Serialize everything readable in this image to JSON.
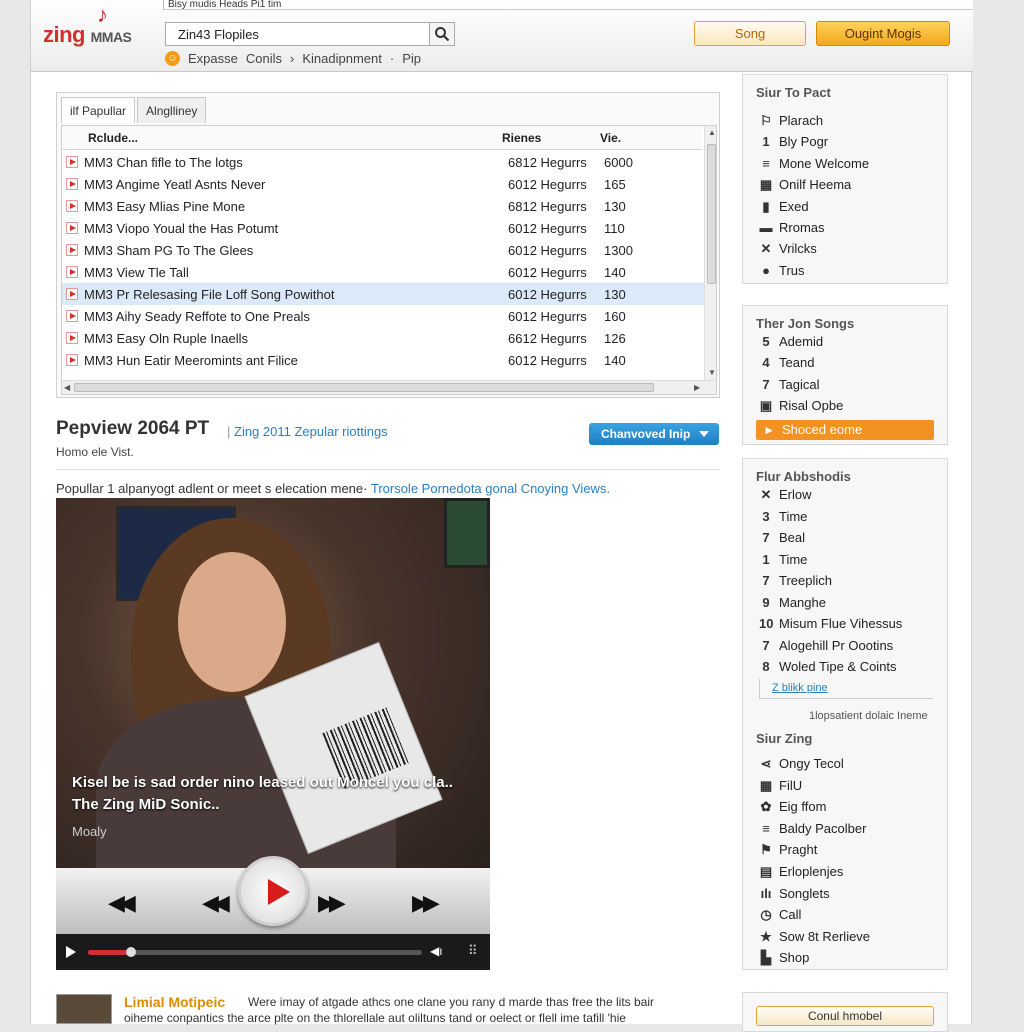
{
  "window": {
    "title": "Bisy mudis Heads Pi1 tim"
  },
  "logo": {
    "text": "zing",
    "suffix": "MMAS"
  },
  "search": {
    "value": "Zin43 Flopiles"
  },
  "subnav": [
    "Expasse",
    "Conils",
    "Kinadipnment",
    "Pip"
  ],
  "header_buttons": {
    "song": "Song",
    "login": "Ougint Mogis"
  },
  "tabs": [
    "ilf Papullar",
    "Alnglliney"
  ],
  "table": {
    "headers": [
      "Rclude...",
      "Rienes",
      "Vie."
    ],
    "rows": [
      {
        "title": "MM3 Chan fifle to The lotgs",
        "artist": "6812 Hegurrs",
        "views": "6000"
      },
      {
        "title": "MM3 Angime Yeatl Asnts Never",
        "artist": "6012 Hegurrs",
        "views": "165"
      },
      {
        "title": "MM3 Easy Mlias Pine Mone",
        "artist": "6812 Hegurrs",
        "views": "130"
      },
      {
        "title": "MM3 Viopo Youal the Has Potumt",
        "artist": "6012 Hegurrs",
        "views": "110"
      },
      {
        "title": "MM3 Sham PG To The Glees",
        "artist": "6012 Hegurrs",
        "views": "1300"
      },
      {
        "title": "MM3 View Tle Tall",
        "artist": "6012 Hegurrs",
        "views": "140"
      },
      {
        "title": "MM3 Pr Relesasing File Loff Song Powithot",
        "artist": "6012 Hegurrs",
        "views": "130"
      },
      {
        "title": "MM3 Aihy Seady Reffote to One Preals",
        "artist": "6012 Hegurrs",
        "views": "160"
      },
      {
        "title": "MM3 Easy Oln Ruple Inaells",
        "artist": "6612 Hegurrs",
        "views": "126"
      },
      {
        "title": "MM3 Hun Eatir Meeromints ant Filice",
        "artist": "6012 Hegurrs",
        "views": "140"
      }
    ],
    "selected_row": 6
  },
  "preview": {
    "title": "Pepview 2064 PT",
    "link": "Zing 2011 Zepular riottings",
    "subtitle": "Homo ele Vist.",
    "changed_button": "Chanvoved Inip"
  },
  "description": {
    "text": "Popullar 1 alpanyogt adlent or meet s elecation mene·",
    "link": "Trorsole Pornedota gonal Cnoying Views."
  },
  "video": {
    "caption1": "Kisel be is sad order nino leased out Moncel you cla..",
    "caption2": "The Zing MiD Sonic..",
    "caption3": "Moaly",
    "progress": 0.13
  },
  "footer": {
    "title": "Limial Motipeic",
    "text": "Were imay of atgade athcs one clane you rany d marde thas free the lits bair",
    "text2": "oiheme conpantics the arce plte on the thlorellale aut oliltuns tand or oelect or flell ime tafill 'hie"
  },
  "sidebar": {
    "box1": {
      "title": "Siur To Pact",
      "items": [
        {
          "icon": "tag-icon",
          "glyph": "⚐",
          "label": "Plarach"
        },
        {
          "icon": "number-1-icon",
          "glyph": "1",
          "label": "Bly Pogr"
        },
        {
          "icon": "list-icon",
          "glyph": "≡",
          "label": "Mone Welcome"
        },
        {
          "icon": "grid-icon",
          "glyph": "▦",
          "label": "Onilf Heema"
        },
        {
          "icon": "bookmark-icon",
          "glyph": "▮",
          "label": "Exed"
        },
        {
          "icon": "card-icon",
          "glyph": "▬",
          "label": "Rromas"
        },
        {
          "icon": "cross-icon",
          "glyph": "✕",
          "label": "Vrilcks"
        },
        {
          "icon": "circle-icon",
          "glyph": "●",
          "label": "Trus"
        }
      ]
    },
    "box2": {
      "title": "Ther Jon Songs",
      "items": [
        {
          "icon": "number-5-icon",
          "glyph": "5",
          "label": "Ademid"
        },
        {
          "icon": "number-4-icon",
          "glyph": "4",
          "label": "Teand"
        },
        {
          "icon": "number-7-icon",
          "glyph": "7",
          "label": "Tagical"
        },
        {
          "icon": "square-icon",
          "glyph": "▣",
          "label": "Risal Opbe"
        },
        {
          "icon": "play-icon",
          "glyph": "▸",
          "label": "Shoced eome"
        }
      ]
    },
    "box3": {
      "title": "Flur Abbshodis",
      "items": [
        {
          "icon": "cross-icon",
          "glyph": "✕",
          "label": "Erlow"
        },
        {
          "icon": "number-3-icon",
          "glyph": "3",
          "label": "Time"
        },
        {
          "icon": "number-7-icon",
          "glyph": "7",
          "label": "Beal"
        },
        {
          "icon": "number-1-icon",
          "glyph": "1",
          "label": "Time"
        },
        {
          "icon": "number-7-icon",
          "glyph": "7",
          "label": "Treeplich"
        },
        {
          "icon": "number-9-icon",
          "glyph": "9",
          "label": "Manghe"
        },
        {
          "icon": "number-10-icon",
          "glyph": "10",
          "label": "Misum Flue Vihessus"
        },
        {
          "icon": "number-7-icon",
          "glyph": "7",
          "label": "Alogehill Pr Oootins"
        },
        {
          "icon": "number-8-icon",
          "glyph": "8",
          "label": "Woled Tipe & Coints"
        }
      ],
      "link": "Z blikk pine",
      "note": "1lopsatient dolaic Ineme"
    },
    "box4": {
      "title": "Siur Zing",
      "items": [
        {
          "icon": "share-icon",
          "glyph": "⋖",
          "label": "Ongy Tecol"
        },
        {
          "icon": "grid-icon",
          "glyph": "▦",
          "label": "FilU"
        },
        {
          "icon": "gift-icon",
          "glyph": "✿",
          "label": "Eig ffom"
        },
        {
          "icon": "list-icon",
          "glyph": "≡",
          "label": "Baldy Pacolber"
        },
        {
          "icon": "pin-icon",
          "glyph": "⚑",
          "label": "Praght"
        },
        {
          "icon": "window-icon",
          "glyph": "▤",
          "label": "Erloplenjes"
        },
        {
          "icon": "bars-icon",
          "glyph": "ılı",
          "label": "Songlets"
        },
        {
          "icon": "clock-icon",
          "glyph": "◷",
          "label": "Call"
        },
        {
          "icon": "star-icon",
          "glyph": "★",
          "label": "Sow 8t Rerlieve"
        },
        {
          "icon": "cart-icon",
          "glyph": "▙",
          "label": "Shop"
        }
      ]
    },
    "contact_button": "Conul hmobel"
  }
}
